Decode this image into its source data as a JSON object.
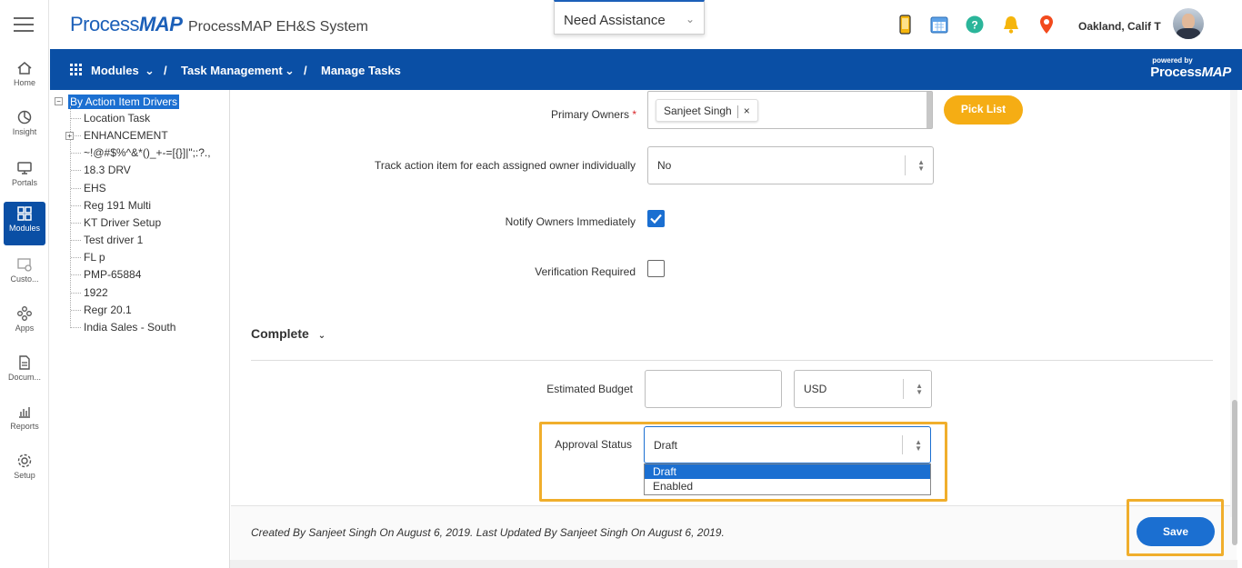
{
  "header": {
    "logo_part1": "Process",
    "logo_part2": "MAP",
    "app_title": "ProcessMAP EH&S System",
    "assistance_label": "Need Assistance",
    "user_name": "Oakland, Calif T",
    "icons": [
      "mobile-icon",
      "calendar-icon",
      "help-icon",
      "bell-icon",
      "location-pin-icon"
    ],
    "colors": {
      "accent": "#0a4fa5",
      "brand": "#1b5fb8"
    }
  },
  "rail": {
    "items": [
      {
        "label": "Home",
        "icon": "home-icon"
      },
      {
        "label": "Insight",
        "icon": "chart-icon"
      },
      {
        "label": "Portals",
        "icon": "monitor-icon"
      },
      {
        "label": "Modules",
        "icon": "grid-icon",
        "active": true
      },
      {
        "label": "Custo...",
        "icon": "customize-icon"
      },
      {
        "label": "Apps",
        "icon": "apps-icon"
      },
      {
        "label": "Docum...",
        "icon": "document-icon"
      },
      {
        "label": "Reports",
        "icon": "reports-icon"
      },
      {
        "label": "Setup",
        "icon": "gear-icon"
      }
    ]
  },
  "nav": {
    "modules": "Modules",
    "sep1": "/",
    "task_management": "Task Management",
    "sep2": "/",
    "manage_tasks": "Manage Tasks",
    "powered_by": "powered by",
    "powered_logo_1": "Process",
    "powered_logo_2": "MAP"
  },
  "tree": {
    "root": "By Action Item Drivers",
    "items": [
      "Location Task",
      "ENHANCEMENT",
      "~!@#$%^&*()_+-=[{}]|\";:?.,",
      "18.3 DRV",
      "EHS",
      "Reg 191 Multi",
      "KT Driver Setup",
      "Test driver 1",
      "FL p",
      "PMP-65884",
      "1922",
      "Regr 20.1",
      "India Sales - South"
    ]
  },
  "form": {
    "primary_owners_label": "Primary Owners",
    "required_mark": "*",
    "owner_chip": "Sanjeet Singh",
    "chip_remove": "×",
    "pick_list": "Pick List",
    "track_label": "Track action item for each assigned owner individually",
    "track_value": "No",
    "notify_label": "Notify Owners Immediately",
    "notify_checked": true,
    "verification_label": "Verification Required",
    "verification_checked": false,
    "section_complete": "Complete",
    "budget_label": "Estimated Budget",
    "budget_value": "",
    "currency_value": "USD",
    "approval_label": "Approval Status",
    "approval_value": "Draft",
    "approval_options": [
      "Draft",
      "Enabled"
    ]
  },
  "footer": {
    "audit_text": "Created By Sanjeet Singh On August 6, 2019. Last Updated By Sanjeet Singh On August 6, 2019.",
    "save": "Save"
  }
}
